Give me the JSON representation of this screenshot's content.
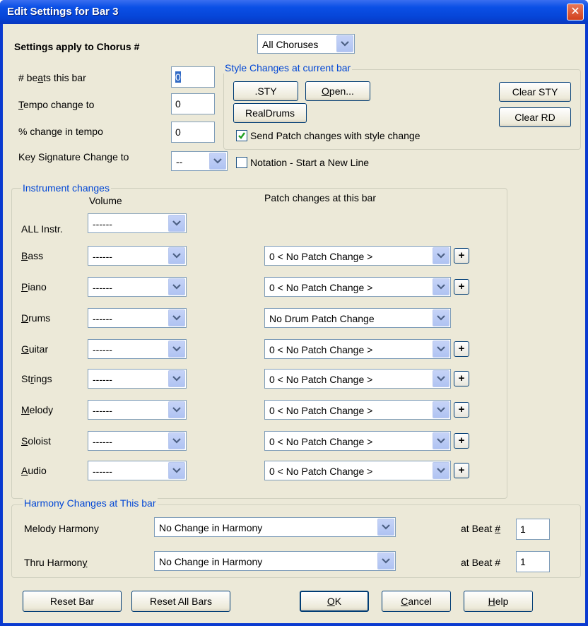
{
  "window": {
    "title": "Edit Settings for Bar 3"
  },
  "chorus": {
    "label": "Settings apply to Chorus #",
    "value": "All Choruses"
  },
  "beats": {
    "label_pre": "# be",
    "label_u": "a",
    "label_post": "ts this bar",
    "value": "0"
  },
  "tempo": {
    "label_u": "T",
    "label_post": "empo change to",
    "value": "0"
  },
  "pct_tempo": {
    "label": "% change in tempo",
    "value": "0"
  },
  "key_sig": {
    "label": "Key Signature Change to",
    "value": "--"
  },
  "style": {
    "group_title": "Style Changes at current bar",
    "sty_button": ".STY",
    "open_button_u": "O",
    "open_button_post": "pen...",
    "realdrums_button": "RealDrums",
    "clear_sty_button": "Clear STY",
    "clear_rd_button": "Clear RD",
    "send_patch_label": "Send Patch changes with style change",
    "send_patch_checked": true
  },
  "notation": {
    "label": "Notation - Start a New Line",
    "checked": false
  },
  "instruments": {
    "group_title": "Instrument changes",
    "volume_header": "Volume",
    "patch_header": "Patch changes at this bar",
    "all_label": "ALL Instr.",
    "all_volume": "------",
    "rows": [
      {
        "u": "B",
        "rest": "ass",
        "volume": "------",
        "patch": "0 < No Patch Change >",
        "plus": "+"
      },
      {
        "u": "P",
        "rest": "iano",
        "volume": "------",
        "patch": "0 < No Patch Change >",
        "plus": "+"
      },
      {
        "u": "D",
        "rest": "rums",
        "volume": "------",
        "patch": "No Drum Patch Change",
        "plus": ""
      },
      {
        "u": "G",
        "rest": "uitar",
        "volume": "------",
        "patch": "0 < No Patch Change >",
        "plus": "+"
      },
      {
        "pre": "St",
        "u": "r",
        "rest": "ings",
        "volume": "------",
        "patch": "0 < No Patch Change >",
        "plus": "+"
      },
      {
        "u": "M",
        "rest": "elody",
        "volume": "------",
        "patch": "0 < No Patch Change >",
        "plus": "+"
      },
      {
        "u": "S",
        "rest": "oloist",
        "volume": "------",
        "patch": "0 < No Patch Change >",
        "plus": "+"
      },
      {
        "u": "A",
        "rest": "udio",
        "volume": "------",
        "patch": "0 < No Patch Change >",
        "plus": "+"
      }
    ]
  },
  "harmony": {
    "group_title": "Harmony Changes at This bar",
    "melody_label": "Melody Harmony",
    "melody_value": "No Change in Harmony",
    "melody_beat_label_pre": "at Beat ",
    "melody_beat_label_u": "#",
    "melody_beat": "1",
    "thru_label_pre": "Thru Harmon",
    "thru_label_u": "y",
    "thru_value": "No Change in Harmony",
    "thru_beat_label": "at Beat #",
    "thru_beat": "1"
  },
  "footer": {
    "reset_bar": "Reset Bar",
    "reset_all": "Reset All Bars",
    "ok_u": "O",
    "ok_post": "K",
    "cancel_u": "C",
    "cancel_post": "ancel",
    "help_u": "H",
    "help_post": "elp"
  },
  "colors": {
    "title_bar": "#0645d8",
    "dialog_bg": "#ece9d8",
    "group_title": "#0046d5"
  }
}
